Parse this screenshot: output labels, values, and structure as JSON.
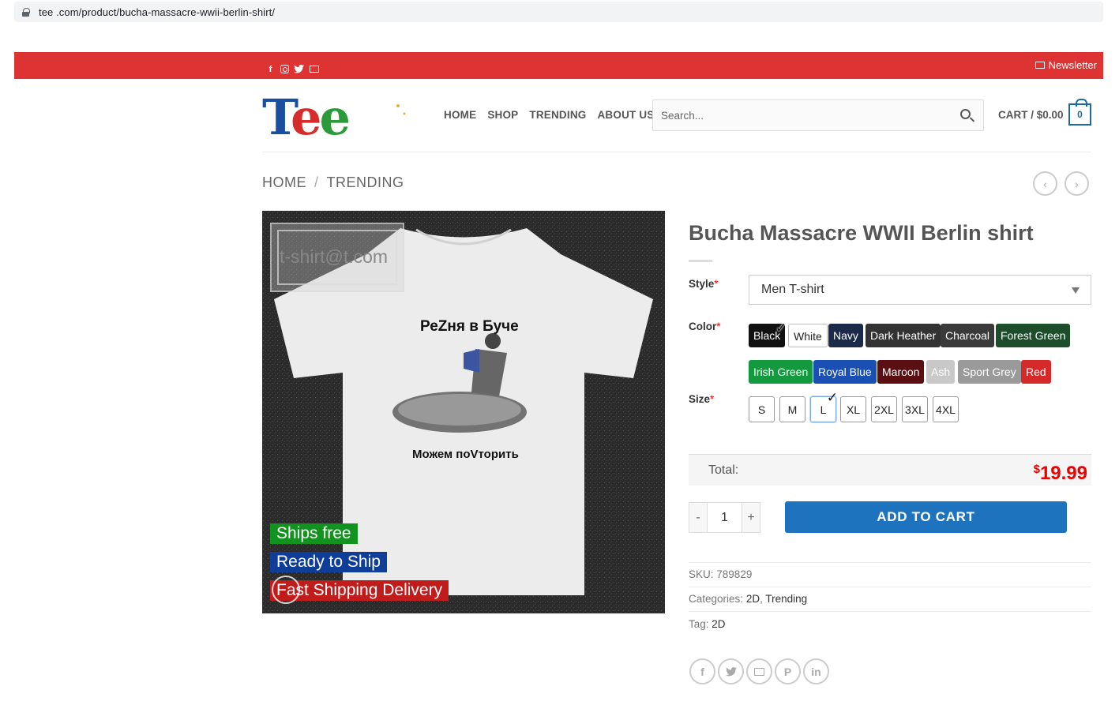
{
  "browser": {
    "url": "tee  .com/product/bucha-massacre-wwii-berlin-shirt/"
  },
  "topbar": {
    "newsletter": "Newsletter",
    "social": [
      "facebook-icon",
      "instagram-icon",
      "twitter-icon",
      "email-icon"
    ]
  },
  "header": {
    "logo": "Tee",
    "nav": [
      "HOME",
      "SHOP",
      "TRENDING",
      "ABOUT US"
    ],
    "search_placeholder": "Search...",
    "cart_label": "CART / $0.00",
    "cart_count": "0"
  },
  "breadcrumb": {
    "home": "HOME",
    "sep": "/",
    "current": "TRENDING"
  },
  "product_image": {
    "watermark": "t-shirt@t.com",
    "print_top": "РеZня в Буче",
    "print_bottom": "Можем поVторить",
    "badges": [
      "Ships free",
      "Ready to Ship",
      "Fast Shipping Delivery"
    ]
  },
  "product": {
    "title": "Bucha Massacre WWII Berlin shirt",
    "style_label": "Style",
    "style_value": "Men T-shirt",
    "color_label": "Color",
    "colors_row1": [
      "Black",
      "White",
      "Navy",
      "Dark Heather",
      "Charcoal",
      "Forest Green"
    ],
    "colors_row2": [
      "Irish Green",
      "Royal Blue",
      "Maroon",
      "Ash",
      "Sport Grey",
      "Red"
    ],
    "selected_color": "Black",
    "size_label": "Size",
    "sizes": [
      "S",
      "M",
      "L",
      "XL",
      "2XL",
      "3XL",
      "4XL"
    ],
    "selected_size": "L",
    "required_mark": "*",
    "total_label": "Total:",
    "total_currency": "$",
    "total_value": "19.99",
    "qty_minus": "-",
    "qty_value": "1",
    "qty_plus": "+",
    "add_to_cart": "ADD TO CART",
    "sku_label": "SKU:",
    "sku": "789829",
    "categories_label": "Categories:",
    "categories": [
      "2D",
      "Trending"
    ],
    "tag_label": "Tag:",
    "tag": "2D"
  },
  "colors": {
    "accent_red": "#dd3333",
    "button_blue": "#1e73be",
    "price_red": "#e00000"
  }
}
